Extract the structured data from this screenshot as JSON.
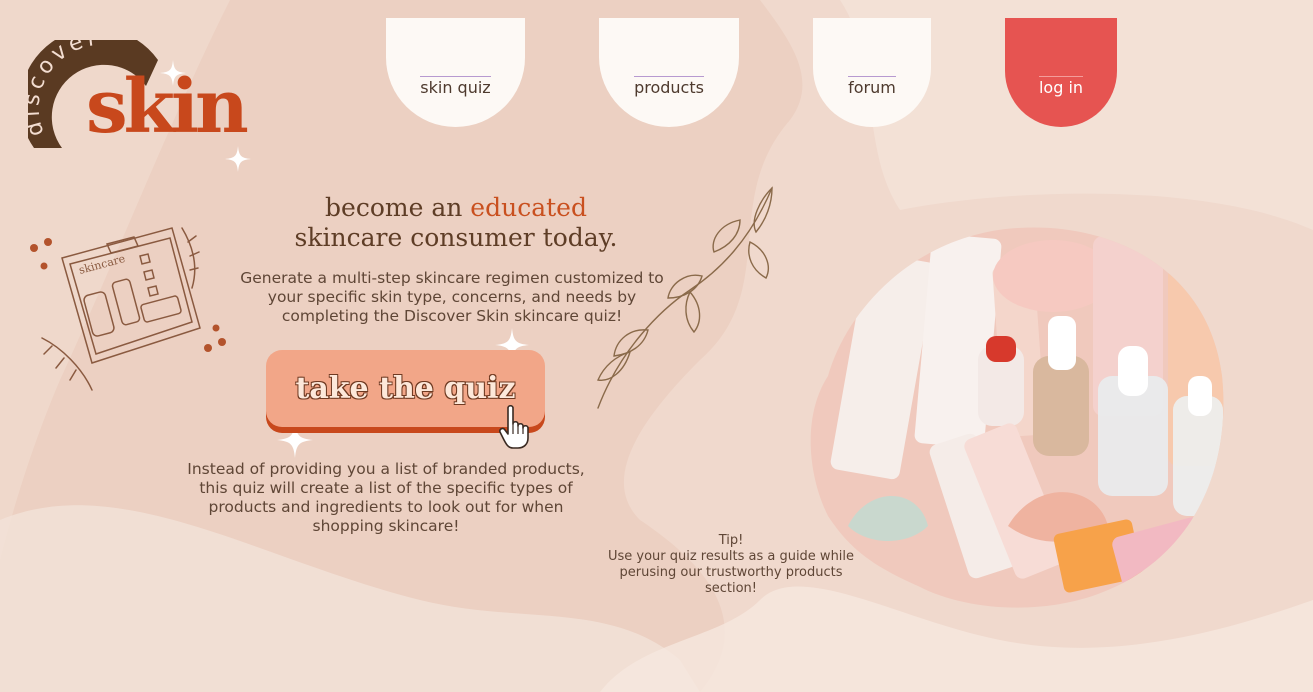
{
  "logo": {
    "arc_text": "discover",
    "word": "skin"
  },
  "nav": {
    "items": [
      {
        "label": "skin quiz"
      },
      {
        "label": "products"
      },
      {
        "label": "forum"
      },
      {
        "label": "log in"
      }
    ]
  },
  "hero": {
    "headline_pre": "become an ",
    "headline_accent": "educated",
    "headline_line2": "skincare consumer today.",
    "subtext": "Generate a multi-step skincare regimen customized to your specific skin type, concerns, and needs by completing the Discover Skin skincare quiz!",
    "cta_label": "take the quiz",
    "note": "Instead of providing you a list of branded products, this quiz will create a list of the specific types of products and ingredients to look out for when shopping skincare!"
  },
  "tip": {
    "title": "Tip!",
    "text": "Use your quiz results as a guide while perusing our trustworthy products section!"
  },
  "doodle": {
    "label": "skincare"
  },
  "colors": {
    "background": "#eccfc1",
    "accent": "#c8481c",
    "nav_tab": "#fdf9f5",
    "login": "#e65451",
    "button": "#f2a688"
  }
}
